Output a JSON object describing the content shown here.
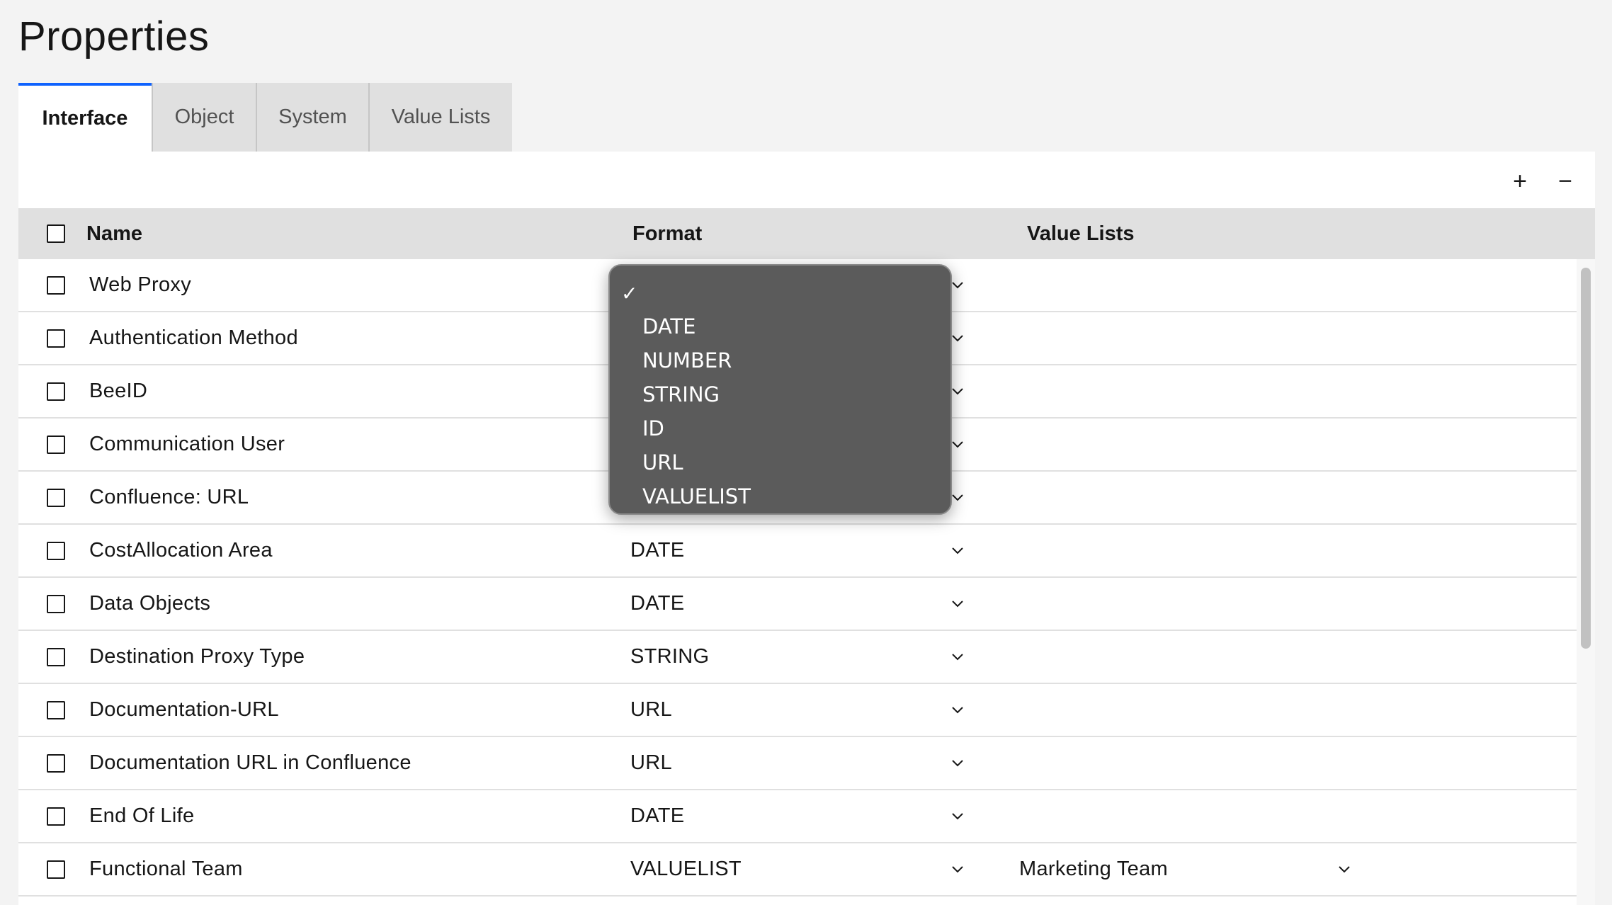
{
  "page": {
    "title": "Properties"
  },
  "tabs": [
    {
      "label": "Interface",
      "active": true
    },
    {
      "label": "Object",
      "active": false
    },
    {
      "label": "System",
      "active": false
    },
    {
      "label": "Value Lists",
      "active": false
    }
  ],
  "toolbar": {
    "add_label": "+",
    "remove_label": "−"
  },
  "table": {
    "columns": {
      "name": "Name",
      "format": "Format",
      "value_lists": "Value Lists"
    },
    "rows": [
      {
        "name": "Web Proxy",
        "format": "",
        "value_list": ""
      },
      {
        "name": "Authentication Method",
        "format": "",
        "value_list": ""
      },
      {
        "name": "BeeID",
        "format": "",
        "value_list": ""
      },
      {
        "name": "Communication User",
        "format": "",
        "value_list": ""
      },
      {
        "name": "Confluence: URL",
        "format": "",
        "value_list": ""
      },
      {
        "name": "CostAllocation Area",
        "format": "DATE",
        "value_list": ""
      },
      {
        "name": "Data Objects",
        "format": "DATE",
        "value_list": ""
      },
      {
        "name": "Destination Proxy Type",
        "format": "STRING",
        "value_list": ""
      },
      {
        "name": "Documentation-URL",
        "format": "URL",
        "value_list": ""
      },
      {
        "name": "Documentation URL in Confluence",
        "format": "URL",
        "value_list": ""
      },
      {
        "name": "End Of Life",
        "format": "DATE",
        "value_list": ""
      },
      {
        "name": "Functional Team",
        "format": "VALUELIST",
        "value_list": "Marketing Team"
      }
    ]
  },
  "format_dropdown": {
    "open": true,
    "check_glyph": "✓",
    "options": [
      "",
      "DATE",
      "NUMBER",
      "STRING",
      "ID",
      "URL",
      "VALUELIST"
    ],
    "selected_index": 0
  },
  "colors": {
    "accent": "#0f62fe",
    "header_bg": "#e0e0e0",
    "dropdown_bg": "#5b5b5b"
  }
}
